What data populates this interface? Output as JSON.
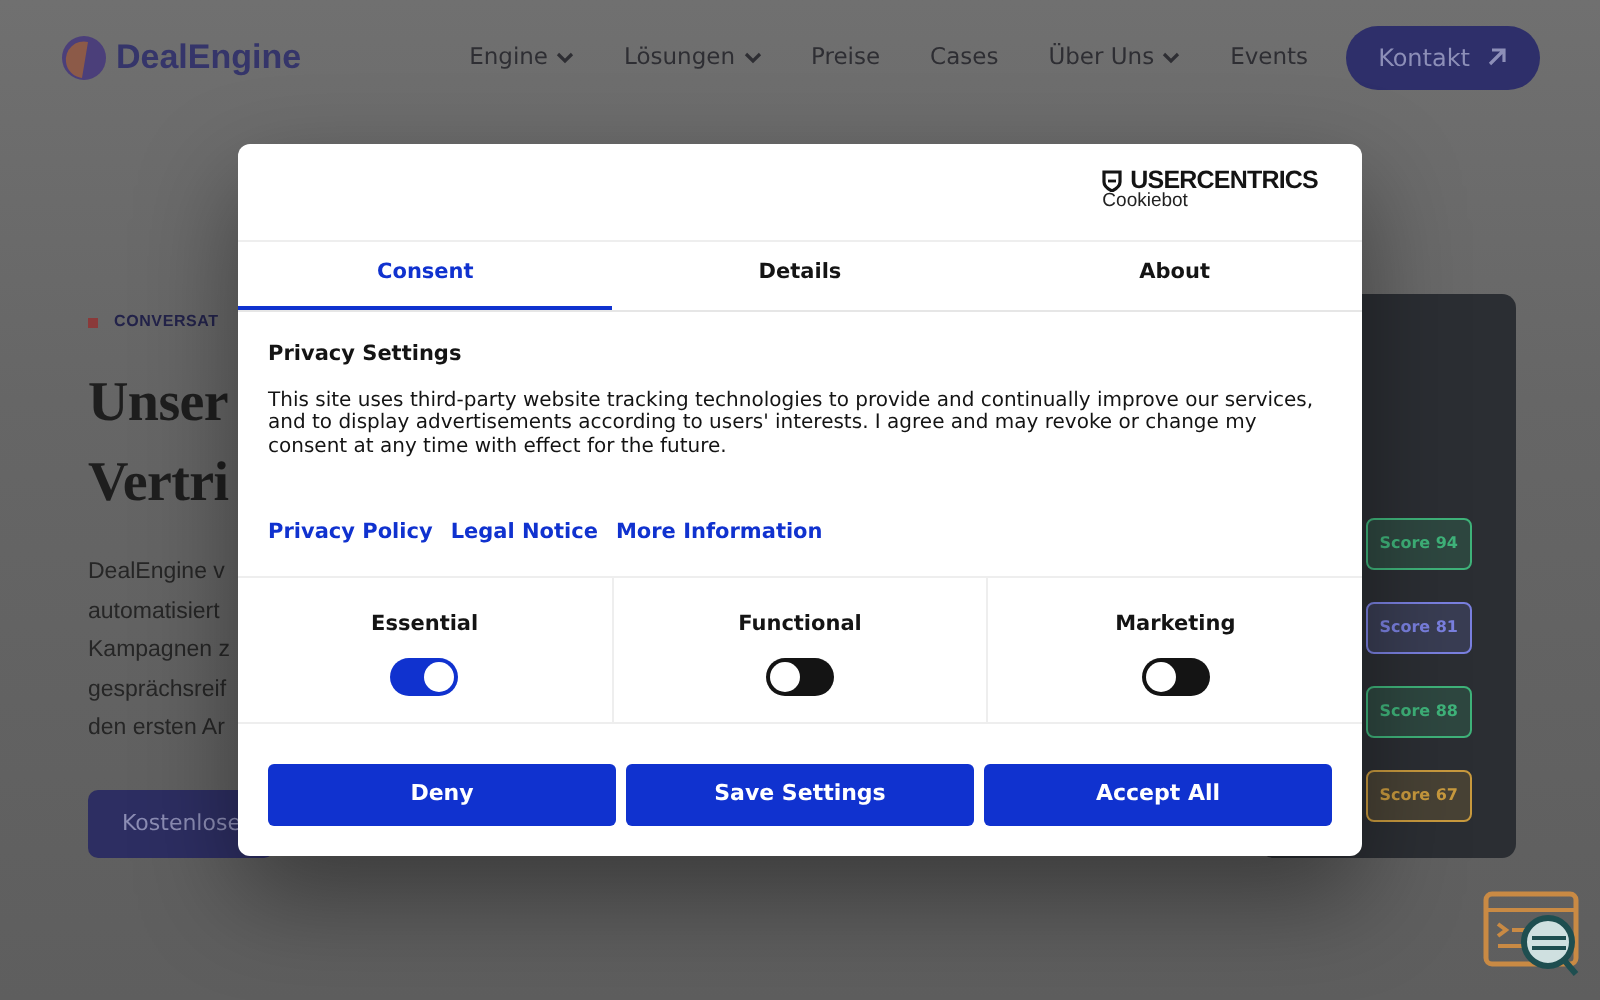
{
  "nav": {
    "logo": "DealEngine",
    "items": [
      {
        "label": "Engine",
        "dropdown": true
      },
      {
        "label": "Lösungen",
        "dropdown": true
      },
      {
        "label": "Preise",
        "dropdown": false
      },
      {
        "label": "Cases",
        "dropdown": false
      },
      {
        "label": "Über Uns",
        "dropdown": true
      },
      {
        "label": "Events",
        "dropdown": false
      }
    ],
    "cta": "Kontakt"
  },
  "hero": {
    "eyebrow": "CONVERSAT",
    "heading_lines": [
      "Unser",
      "Vertri"
    ],
    "paragraph_lines": [
      "DealEngine v",
      "automatisiert",
      "Kampagnen z",
      "gesprächsreif",
      "den ersten Ar"
    ],
    "button": "Kostenlose"
  },
  "side_card": {
    "scores": [
      {
        "label": "Score 94",
        "color": "#3fb37a"
      },
      {
        "label": "Score 81",
        "color": "#7a80e0"
      },
      {
        "label": "Score 88",
        "color": "#3fb37a"
      },
      {
        "label": "Score 67",
        "color": "#c99a3e"
      }
    ]
  },
  "dialog": {
    "brand": {
      "name": "USERCENTRICS",
      "sub": "Cookiebot"
    },
    "tabs": [
      {
        "label": "Consent",
        "selected": true
      },
      {
        "label": "Details",
        "selected": false
      },
      {
        "label": "About",
        "selected": false
      }
    ],
    "title": "Privacy Settings",
    "text": "This site uses third-party website tracking technologies to provide and continually improve our services, and to display advertisements according to users' interests. I agree and may revoke or change my consent at any time with effect for the future.",
    "links": [
      "Privacy Policy",
      "Legal Notice",
      "More Information"
    ],
    "categories": [
      {
        "label": "Essential",
        "on": true
      },
      {
        "label": "Functional",
        "on": false
      },
      {
        "label": "Marketing",
        "on": false
      }
    ],
    "buttons": [
      "Deny",
      "Save Settings",
      "Accept All"
    ]
  }
}
